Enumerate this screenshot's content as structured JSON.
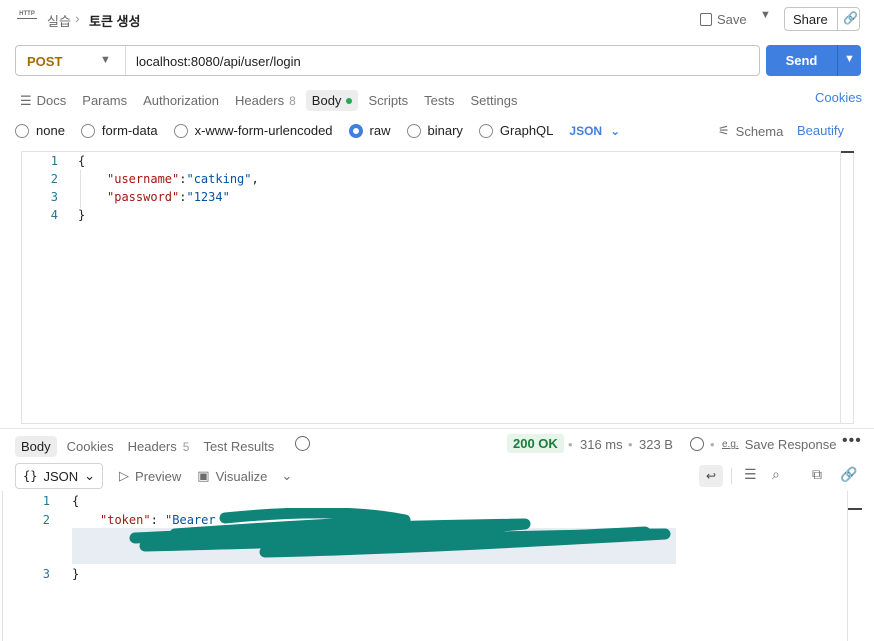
{
  "header": {
    "breadcrumb_parent": "실습",
    "breadcrumb_sep": "›",
    "title": "토큰 생성",
    "http_icon_text": "HTTP",
    "save_label": "Save",
    "share_label": "Share"
  },
  "request": {
    "method": "POST",
    "url": "localhost:8080/api/user/login",
    "send_label": "Send"
  },
  "request_tabs": {
    "docs": "Docs",
    "params": "Params",
    "authorization": "Authorization",
    "headers": "Headers",
    "headers_count": "8",
    "body": "Body",
    "scripts": "Scripts",
    "tests": "Tests",
    "settings": "Settings",
    "cookies": "Cookies"
  },
  "body_types": {
    "none": "none",
    "form_data": "form-data",
    "urlencoded": "x-www-form-urlencoded",
    "raw": "raw",
    "binary": "binary",
    "graphql": "GraphQL",
    "format": "JSON",
    "schema": "Schema",
    "beautify": "Beautify"
  },
  "request_body": {
    "lines": [
      {
        "n": "1",
        "text": "{"
      },
      {
        "n": "2",
        "key": "\"username\"",
        "colon": ":",
        "value": "\"catking\"",
        "tail": ","
      },
      {
        "n": "3",
        "key": "\"password\"",
        "colon": ":",
        "value": "\"1234\"",
        "tail": ""
      },
      {
        "n": "4",
        "text": "}"
      }
    ]
  },
  "response_tabs": {
    "body": "Body",
    "cookies": "Cookies",
    "headers": "Headers",
    "headers_count": "5",
    "test_results": "Test Results"
  },
  "response_meta": {
    "status": "200 OK",
    "time": "316 ms",
    "size": "323 B",
    "save_response": "Save Response",
    "eg": "e.g."
  },
  "response_toolbar": {
    "format": "JSON",
    "preview": "Preview",
    "visualize": "Visualize"
  },
  "response_body": {
    "line1_n": "1",
    "line1": "{",
    "line2_n": "2",
    "token_key": "\"token\"",
    "token_colon": ": ",
    "token_value_visible": "\"Bearer",
    "line3_n": "3",
    "line3": "}"
  },
  "colors": {
    "accent": "#3f7fe0",
    "method": "#a36c00",
    "status_ok": "#1e7a3c",
    "redaction": "#0f8478"
  }
}
